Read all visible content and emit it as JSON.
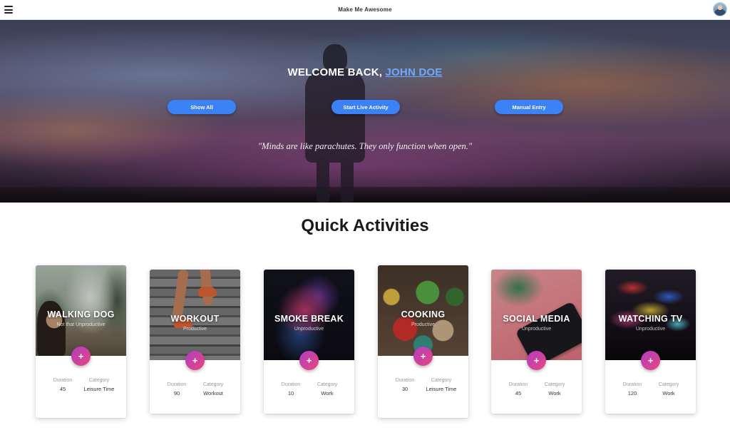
{
  "navbar": {
    "title": "Make Me Awesome",
    "menu_icon": "hamburger-icon",
    "avatar_icon": "user-avatar"
  },
  "hero": {
    "welcome_prefix": "WELCOME BACK,",
    "user_name": "JOHN DOE",
    "buttons": {
      "show_all": "Show All",
      "start_live": "Start Live Activity",
      "manual_entry": "Manual Entry"
    },
    "quote": "\"Minds are like parachutes. They only function when open.\""
  },
  "section": {
    "title": "Quick Activities"
  },
  "labels": {
    "duration": "Duration",
    "category": "Category",
    "add": "+"
  },
  "activities": [
    {
      "title": "WALKING DOG",
      "subtitle": "Not that Unproductive",
      "duration": "45",
      "category": "Leisure Time"
    },
    {
      "title": "WORKOUT",
      "subtitle": "Productive",
      "duration": "90",
      "category": "Workout"
    },
    {
      "title": "SMOKE BREAK",
      "subtitle": "Unproductive",
      "duration": "10",
      "category": "Work"
    },
    {
      "title": "COOKING",
      "subtitle": "Productive",
      "duration": "30",
      "category": "Leisure Time"
    },
    {
      "title": "SOCIAL MEDIA",
      "subtitle": "Unproductive",
      "duration": "45",
      "category": "Work"
    },
    {
      "title": "WATCHING TV",
      "subtitle": "Unproductive",
      "duration": "120",
      "category": "Work"
    }
  ],
  "colors": {
    "primary_button": "#3b82f6",
    "link": "#6ea8ff",
    "add_gradient_start": "#b03fc0",
    "add_gradient_end": "#e8457f"
  }
}
